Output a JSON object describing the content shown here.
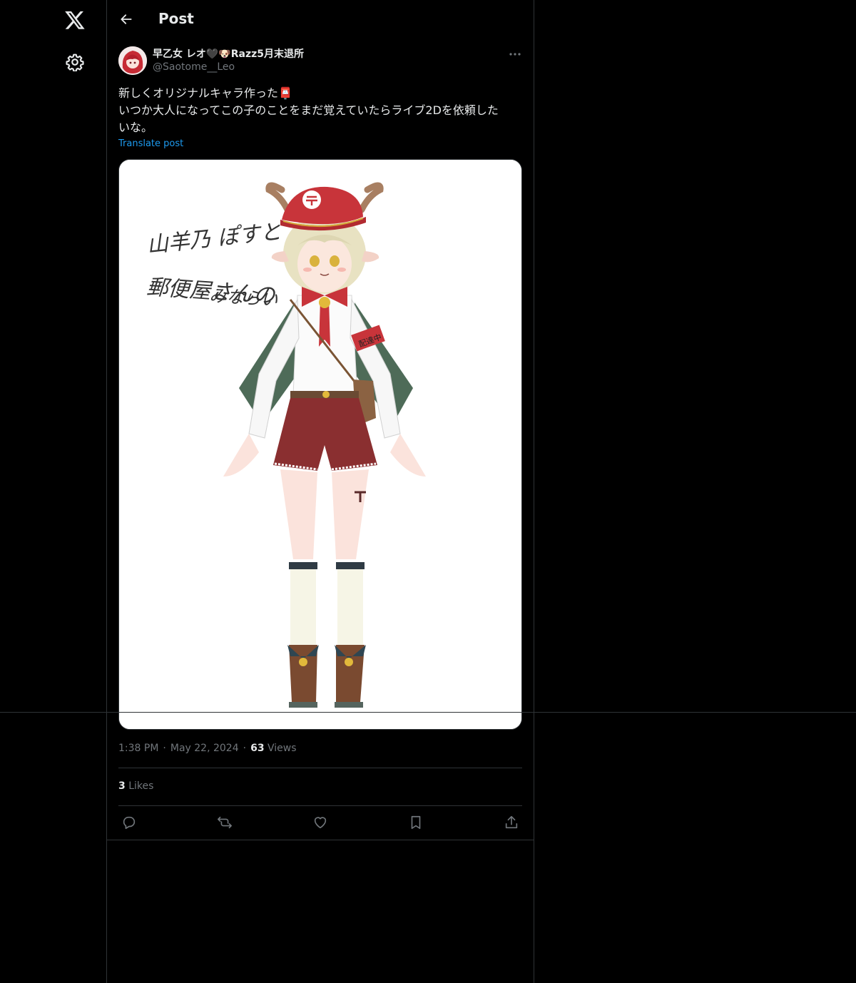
{
  "nav": {
    "logo_icon": "x-logo-icon",
    "settings_icon": "gear-icon"
  },
  "header": {
    "back_icon": "arrow-left-icon",
    "title": "Post"
  },
  "post": {
    "display_name": "早乙女 レオ🖤🐶Razz5月末退所",
    "handle": "@Saotome__Leo",
    "text_lines": [
      "新しくオリジナルキャラ作った📮",
      "いつか大人になってこの子のことをまだ覚えていたらライブ2Dを依頼した",
      "いな。"
    ],
    "translate_label": "Translate post",
    "image": {
      "alt_icon": "character-illustration",
      "handwritten_lines": [
        "山羊乃 ぽすと",
        "郵便屋さんの",
        "みならい"
      ],
      "armband_text": "配達中"
    },
    "time": "1:38 PM",
    "date": "May 22, 2024",
    "views_count": "63",
    "views_label": "Views",
    "likes_count": "3",
    "likes_label": "Likes"
  },
  "colors": {
    "accent": "#1d9bf0",
    "muted": "#71767b",
    "border": "#2f3336",
    "text": "#e7e9ea"
  }
}
